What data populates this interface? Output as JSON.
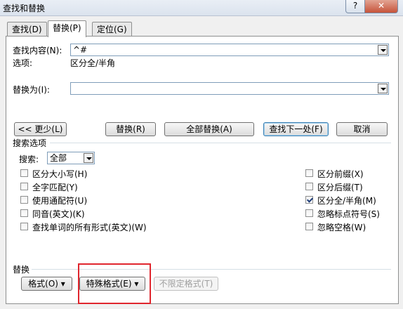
{
  "window": {
    "title": "查找和替换",
    "help_label": "?",
    "close_label": "✕"
  },
  "tabs": [
    {
      "label": "查找(D)"
    },
    {
      "label": "替换(P)"
    },
    {
      "label": "定位(G)"
    }
  ],
  "find": {
    "label": "查找内容(N):",
    "value": "^#",
    "options_label": "选项:",
    "options_value": "区分全/半角"
  },
  "replace": {
    "label": "替换为(I):",
    "value": ""
  },
  "buttons": {
    "less": "<< 更少(L)",
    "replace": "替换(R)",
    "replace_all": "全部替换(A)",
    "find_next": "查找下一处(F)",
    "cancel": "取消"
  },
  "search_options": {
    "section_label": "搜索选项",
    "search_label": "搜索:",
    "search_value": "全部",
    "left_options": [
      {
        "label": "区分大小写(H)",
        "checked": false
      },
      {
        "label": "全字匹配(Y)",
        "checked": false
      },
      {
        "label": "使用通配符(U)",
        "checked": false
      },
      {
        "label": "同音(英文)(K)",
        "checked": false
      },
      {
        "label": "查找单词的所有形式(英文)(W)",
        "checked": false
      }
    ],
    "right_options": [
      {
        "label": "区分前缀(X)",
        "checked": false
      },
      {
        "label": "区分后缀(T)",
        "checked": false
      },
      {
        "label": "区分全/半角(M)",
        "checked": true
      },
      {
        "label": "忽略标点符号(S)",
        "checked": false
      },
      {
        "label": "忽略空格(W)",
        "checked": false
      }
    ]
  },
  "replace_section": {
    "label": "替换",
    "format": "格式(O) ▾",
    "special": "特殊格式(E) ▾",
    "no_format": "不限定格式(T)"
  }
}
